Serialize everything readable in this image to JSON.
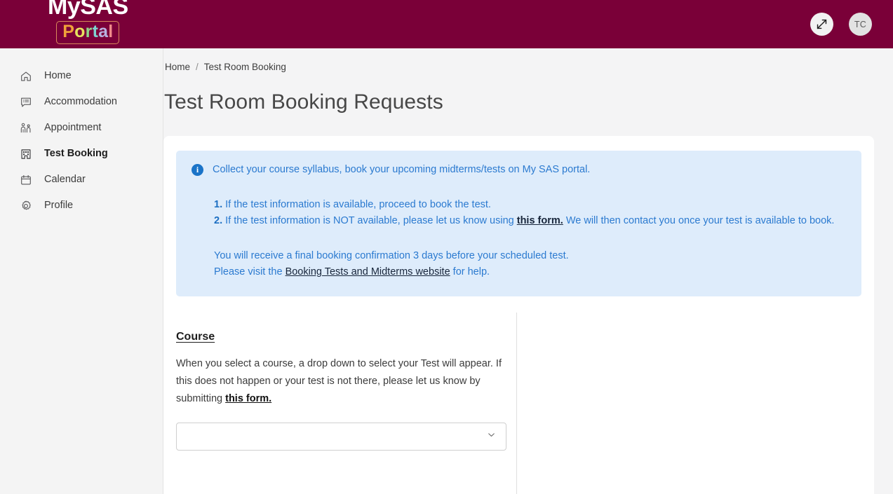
{
  "header": {
    "logo_primary": "MySAS",
    "logo_secondary_letters": [
      "P",
      "o",
      "r",
      "t",
      "a",
      "l"
    ],
    "logo_secondary": "Portal",
    "expand_icon": "expand-diagonal-icon",
    "avatar_initials": "TC",
    "brand_color": "#7a0038"
  },
  "sidebar": {
    "items": [
      {
        "label": "Home",
        "icon": "home-icon",
        "active": false
      },
      {
        "label": "Accommodation",
        "icon": "message-icon",
        "active": false
      },
      {
        "label": "Appointment",
        "icon": "people-icon",
        "active": false
      },
      {
        "label": "Test Booking",
        "icon": "building-icon",
        "active": true
      },
      {
        "label": "Calendar",
        "icon": "calendar-icon",
        "active": false
      },
      {
        "label": "Profile",
        "icon": "gear-icon",
        "active": false
      }
    ]
  },
  "breadcrumb": {
    "home": "Home",
    "separator": "/",
    "current": "Test Room Booking"
  },
  "page": {
    "title": "Test Room Booking Requests"
  },
  "banner": {
    "icon": "info-circle-icon",
    "accent_color": "#2b7ad0",
    "background_color": "#deecfb",
    "lead": "Collect your course syllabus, book your upcoming midterms/tests on My SAS portal.",
    "item1_number": "1.",
    "item1_text": "If the test information is available, proceed to book the test.",
    "item2_number": "2.",
    "item2_text_before": "If the test information is NOT available, please let us know using",
    "item2_link": "this form.",
    "item2_text_after": "We will then contact you once your test is available to book.",
    "confirmation_text": "You will receive a final booking confirmation 3 days before your scheduled test.",
    "help_text_before": "Please visit the",
    "help_link": "Booking Tests and Midterms website",
    "help_text_after": "for help."
  },
  "course_section": {
    "heading": "Course",
    "description_before": "When you select a course, a drop down to select your Test will appear. If this does not happen or your test is not there, please let us know by submitting",
    "description_link": "this form.",
    "select_value": "",
    "select_placeholder": "",
    "chevron_icon": "chevron-down-icon"
  }
}
